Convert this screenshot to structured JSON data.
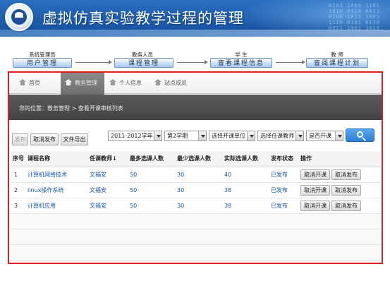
{
  "header": {
    "title": "虚拟仿真实验教学过程的管理",
    "binary_text": "0101 1000 1101\n1010 0110 0011\n0100 1011 1001\n1110 0101 0110\n0011 1001 1010"
  },
  "workflow": [
    {
      "role": "系统管理员",
      "action": "用户管理"
    },
    {
      "role": "教务人员",
      "action": "课程管理"
    },
    {
      "role": "学  生",
      "action": "查看课程信息"
    },
    {
      "role": "教  师",
      "action": "查阅课程计划"
    }
  ],
  "tabs": [
    {
      "label": "首页"
    },
    {
      "label": "教务管理"
    },
    {
      "label": "个人信息"
    },
    {
      "label": "站点成员"
    }
  ],
  "breadcrumb": "您的位置：教务管理 > 查看开课审核列表",
  "toolbar": {
    "publish": "发布",
    "unpublish": "取消发布",
    "export": "文件导出",
    "year": "2011-2012学年",
    "term": "第2学期",
    "unit": "选择开课单位",
    "teacher": "选择任课教师",
    "open": "是否开课"
  },
  "table": {
    "headers": [
      "序号",
      "课程名称",
      "任课教师↓",
      "最多选课人数",
      "最少选课人数",
      "实际选课人数",
      "发布状态",
      "操作"
    ],
    "rows": [
      {
        "no": "1",
        "course": "计算机网络技术",
        "teacher": "文福安",
        "max": "50",
        "min": "30",
        "actual": "40",
        "status": "已发布",
        "btn1": "取消开课",
        "btn2": "取消发布"
      },
      {
        "no": "2",
        "course": "linux操作系统",
        "teacher": "文福安",
        "max": "50",
        "min": "30",
        "actual": "38",
        "status": "已发布",
        "btn1": "取消开课",
        "btn2": "取消发布"
      },
      {
        "no": "3",
        "course": "计算机应用",
        "teacher": "文福安",
        "max": "50",
        "min": "30",
        "actual": "38",
        "status": "已发布",
        "btn1": "取消开课",
        "btn2": "取消发布"
      }
    ]
  }
}
